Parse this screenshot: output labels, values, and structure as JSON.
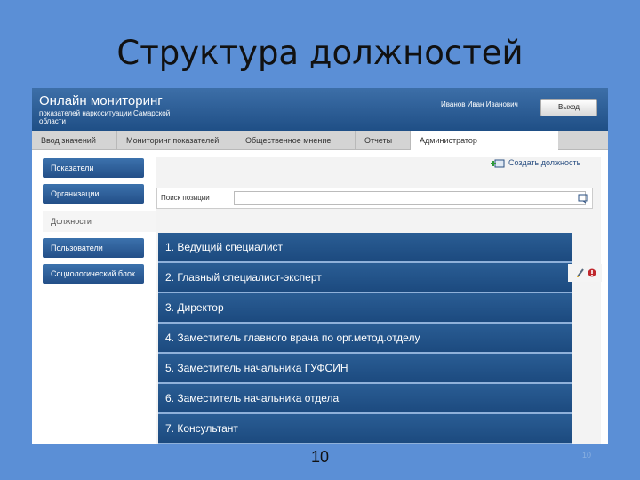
{
  "slide": {
    "title": "Структура должностей",
    "page_number": "10",
    "page_number_faint": "10"
  },
  "header": {
    "app_name": "Онлайн мониторинг",
    "app_subtitle": "показателей наркоситуации Самарской области",
    "user_name": "Иванов Иван Иванович",
    "logout_label": "Выход"
  },
  "nav": {
    "tabs": [
      {
        "label": "Ввод значений"
      },
      {
        "label": "Мониторинг показателей"
      },
      {
        "label": "Общественное мнение"
      },
      {
        "label": "Отчеты"
      },
      {
        "label": "Администратор"
      }
    ],
    "active_tab": "Администратор"
  },
  "sidebar": {
    "items": [
      {
        "label": "Показатели"
      },
      {
        "label": "Организации"
      },
      {
        "label": "Должности"
      },
      {
        "label": "Пользователи"
      },
      {
        "label": "Социологический блок"
      }
    ],
    "active_item": "Должности"
  },
  "content": {
    "create_label": "Создать должность",
    "search_label": "Поиск позиции",
    "search_value": "",
    "positions": [
      {
        "number": "1.",
        "name": "Ведущий специалист"
      },
      {
        "number": "2.",
        "name": "Главный специалист-эксперт"
      },
      {
        "number": "3.",
        "name": "Директор"
      },
      {
        "number": "4.",
        "name": "Заместитель главного врача по орг.метод.отделу"
      },
      {
        "number": "5.",
        "name": "Заместитель начальника ГУФСИН"
      },
      {
        "number": "6.",
        "name": "Заместитель начальника отдела"
      },
      {
        "number": "7.",
        "name": "Консультант"
      }
    ]
  },
  "icons": {
    "create": "add-document-icon",
    "search": "search-icon",
    "edit": "pencil-icon",
    "delete": "delete-icon"
  },
  "colors": {
    "slide_background": "#5b8fd6",
    "header_blue": "#1f4f86",
    "row_blue": "#1c4a7f",
    "row_separator": "#8fb1da"
  }
}
